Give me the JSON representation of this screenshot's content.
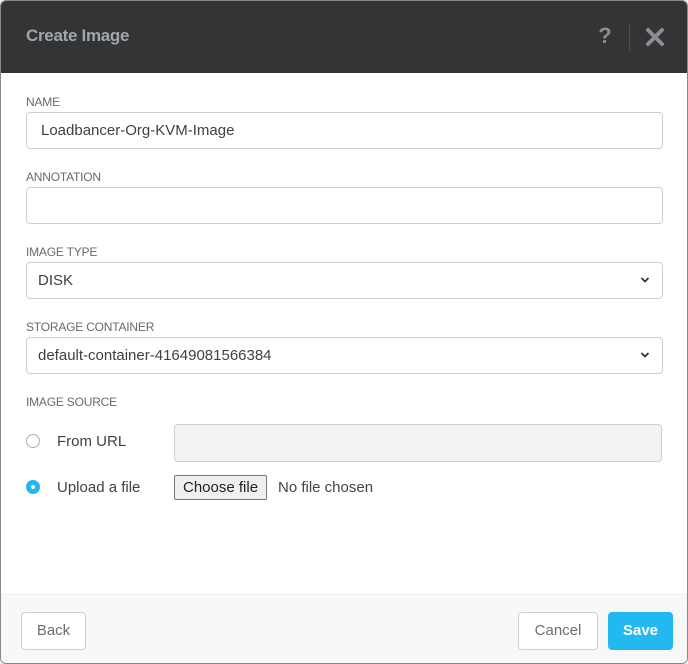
{
  "dialog": {
    "title": "Create Image",
    "help_icon": "?",
    "close_icon": "close-x"
  },
  "form": {
    "name": {
      "label": "NAME",
      "value": "Loadbancer-Org-KVM-Image"
    },
    "annotation": {
      "label": "ANNOTATION",
      "value": ""
    },
    "image_type": {
      "label": "IMAGE TYPE",
      "value": "DISK"
    },
    "storage_container": {
      "label": "STORAGE CONTAINER",
      "value": "default-container-41649081566384"
    },
    "image_source": {
      "label": "IMAGE SOURCE",
      "options": [
        {
          "label": "From URL",
          "selected": false,
          "url_value": ""
        },
        {
          "label": "Upload a file",
          "selected": true
        }
      ],
      "choose_file_label": "Choose file",
      "file_status": "No file chosen"
    }
  },
  "footer": {
    "back_label": "Back",
    "cancel_label": "Cancel",
    "save_label": "Save"
  },
  "colors": {
    "header_bg": "#333436",
    "accent": "#22b8f0"
  }
}
